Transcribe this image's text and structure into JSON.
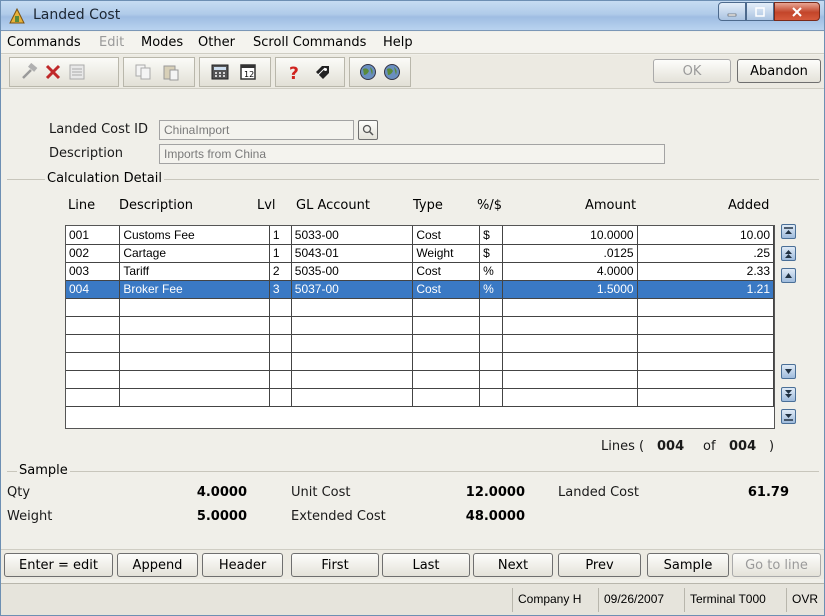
{
  "window": {
    "title": "Landed Cost"
  },
  "menu": {
    "commands": "Commands",
    "edit": "Edit",
    "modes": "Modes",
    "other": "Other",
    "scroll_commands": "Scroll Commands",
    "help": "Help"
  },
  "toolbar": {
    "icons": [
      "hammer-icon",
      "delete-icon",
      "list-icon",
      "copy-icon",
      "paste-icon",
      "calculator-icon",
      "calendar-icon",
      "help-icon",
      "tag-icon",
      "globe-icon",
      "globe-arrow-icon"
    ],
    "ok_label": "OK",
    "abandon_label": "Abandon"
  },
  "header": {
    "landed_cost_id_label": "Landed Cost ID",
    "landed_cost_id_value": "ChinaImport",
    "description_label": "Description",
    "description_value": "Imports from China"
  },
  "calc": {
    "group_label": "Calculation Detail",
    "columns": {
      "line": "Line",
      "description": "Description",
      "lvl": "Lvl",
      "gl_account": "GL Account",
      "type": "Type",
      "pct": "%/$",
      "amount": "Amount",
      "added": "Added"
    },
    "rows": [
      {
        "line": "001",
        "description": "Customs Fee",
        "lvl": "1",
        "gl": "5033-00",
        "type": "Cost",
        "pct": "$",
        "amount": "10.0000",
        "added": "10.00"
      },
      {
        "line": "002",
        "description": "Cartage",
        "lvl": "1",
        "gl": "5043-01",
        "type": "Weight",
        "pct": "$",
        "amount": ".0125",
        "added": ".25"
      },
      {
        "line": "003",
        "description": "Tariff",
        "lvl": "2",
        "gl": "5035-00",
        "type": "Cost",
        "pct": "%",
        "amount": "4.0000",
        "added": "2.33"
      },
      {
        "line": "004",
        "description": "Broker Fee",
        "lvl": "3",
        "gl": "5037-00",
        "type": "Cost",
        "pct": "%",
        "amount": "1.5000",
        "added": "1.21"
      }
    ],
    "selected_row": 3,
    "lines_prefix": "Lines (",
    "lines_current": "004",
    "lines_of": "of",
    "lines_total": "004",
    "lines_suffix": ")"
  },
  "sample": {
    "group_label": "Sample",
    "qty_label": "Qty",
    "qty_value": "4.0000",
    "weight_label": "Weight",
    "weight_value": "5.0000",
    "unit_cost_label": "Unit Cost",
    "unit_cost_value": "12.0000",
    "extended_cost_label": "Extended Cost",
    "extended_cost_value": "48.0000",
    "landed_cost_label": "Landed Cost",
    "landed_cost_value": "61.79"
  },
  "buttons": {
    "enter_edit": "Enter = edit",
    "append": "Append",
    "header": "Header",
    "first": "First",
    "last": "Last",
    "next": "Next",
    "prev": "Prev",
    "sample": "Sample",
    "go_to_line": "Go to line"
  },
  "status": {
    "company": "Company H",
    "date": "09/26/2007",
    "terminal": "Terminal T000",
    "mode": "OVR"
  }
}
